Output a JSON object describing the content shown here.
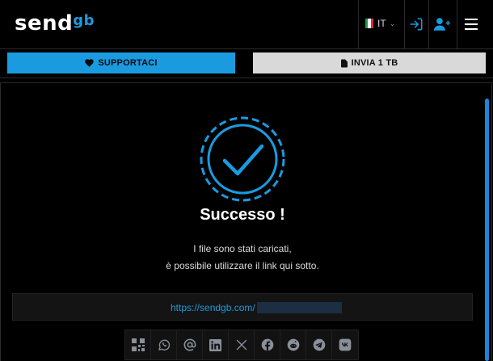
{
  "header": {
    "logo": {
      "main": "send",
      "accent": "gb"
    },
    "language": {
      "code": "IT"
    }
  },
  "tabs": {
    "support_label": "SUPPORTACI",
    "send_label": "INVIA 1 TB"
  },
  "result": {
    "title": "Successo !",
    "message_line1": "I file sono stati caricati,",
    "message_line2": "è possibile utilizzare il link qui sotto.",
    "link_text": "https://sendgb.com/"
  },
  "share_icons": [
    "qr-code-icon",
    "whatsapp-icon",
    "email-at-icon",
    "linkedin-icon",
    "x-icon",
    "facebook-icon",
    "reddit-icon",
    "telegram-icon",
    "vk-icon"
  ],
  "colors": {
    "accent": "#1a9be0",
    "background": "#000000",
    "secondary_button": "#d9d9d9"
  }
}
